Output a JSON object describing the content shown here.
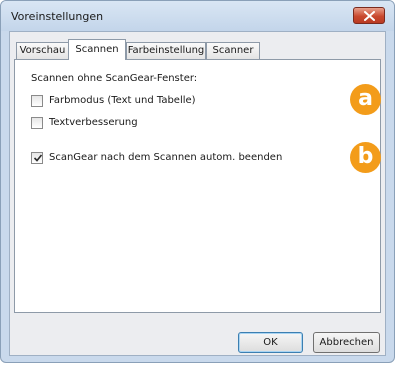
{
  "window": {
    "title": "Voreinstellungen"
  },
  "tabs": [
    {
      "label": "Vorschau",
      "active": false
    },
    {
      "label": "Scannen",
      "active": true
    },
    {
      "label": "Farbeinstellung",
      "active": false
    },
    {
      "label": "Scanner",
      "active": false
    }
  ],
  "scan_group": {
    "label": "Scannen ohne ScanGear-Fenster:",
    "options": [
      {
        "label": "Farbmodus (Text und Tabelle)",
        "checked": false
      },
      {
        "label": "Textverbesserung",
        "checked": false
      }
    ]
  },
  "auto_close": {
    "label": "ScanGear nach dem Scannen autom. beenden",
    "checked": true
  },
  "callouts": {
    "a": "a",
    "b": "b",
    "color": "#f39c1a"
  },
  "buttons": {
    "ok": "OK",
    "cancel": "Abbrechen"
  },
  "icons": {
    "close": "close-x-icon",
    "check": "checkmark-icon"
  }
}
